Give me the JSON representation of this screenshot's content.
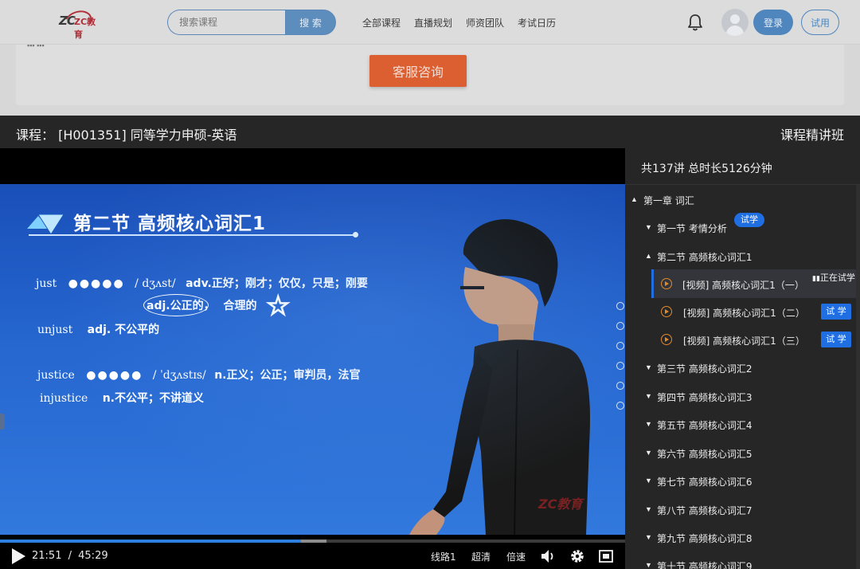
{
  "header": {
    "logo_text": "ZC教育",
    "search_placeholder": "搜索课程",
    "search_button": "搜 索",
    "nav": [
      "全部课程",
      "直播规划",
      "师资团队",
      "考试日历"
    ],
    "login_label": "登录",
    "trial_label": "试用"
  },
  "banner": {
    "service_button": "客服咨询"
  },
  "player": {
    "course_title": "课程：  [H001351] 同等学力申硕-英语",
    "class_type": "课程精讲班",
    "slide": {
      "title": "第二节  高频核心词汇1",
      "lines": [
        {
          "word": "just",
          "phonetic": "/ dʒʌst/",
          "meaning": "adv.正好；刚才；仅仅，只是；刚要"
        },
        {
          "word": "",
          "phonetic": "adj.公正的，",
          "meaning": "合理的"
        },
        {
          "word": "unjust",
          "phonetic": "",
          "meaning": "adj. 不公平的"
        },
        {
          "word": "justice",
          "phonetic": "/ ˈdʒʌstɪs/",
          "meaning": "n.正义；公正；审判员，法官"
        },
        {
          "word": "injustice",
          "phonetic": "",
          "meaning": "n.不公平；不讲道义"
        }
      ],
      "watermark": "ZC教育"
    },
    "controls": {
      "current_time": "21:51",
      "separator": "/",
      "duration": "45:29",
      "line": "线路1",
      "quality": "超清",
      "speed": "倍速"
    },
    "progress": {
      "played_fraction": 0.481,
      "buffered_fraction": 0.522
    }
  },
  "playlist": {
    "summary": "共137讲 总时长5126分钟",
    "chapter": "第一章 词汇",
    "section1": "第一节 考情分析",
    "section1_badge": "试学",
    "section2": "第二节 高频核心词汇1",
    "lessons": [
      {
        "title": "[视频]  高频核心词汇1（一）",
        "status": "正在试学"
      },
      {
        "title": "[视频]  高频核心词汇1（二）",
        "tag": "试 学"
      },
      {
        "title": "[视频]  高频核心词汇1（三）",
        "tag": "试 学"
      }
    ],
    "sections": [
      "第三节 高频核心词汇2",
      "第四节 高频核心词汇3",
      "第五节 高频核心词汇4",
      "第六节 高频核心词汇5",
      "第七节 高频核心词汇6",
      "第八节 高频核心词汇7",
      "第九节 高频核心词汇8",
      "第十节 高频核心词汇9"
    ]
  },
  "colors": {
    "accent": "#1f6fe3",
    "service_orange": "#dc5f32",
    "lesson_icon": "#e08a2e"
  }
}
